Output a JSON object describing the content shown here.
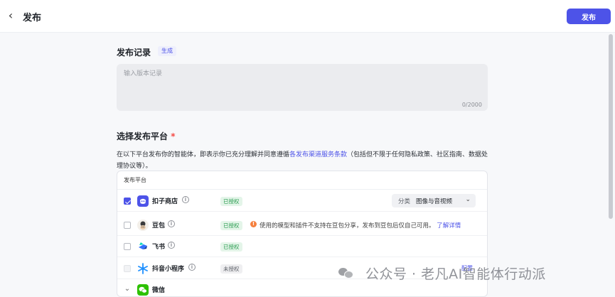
{
  "header": {
    "back_icon": "chevron-left-icon",
    "title": "发布",
    "publish_label": "发布",
    "accent_color": "#4d53e8"
  },
  "record": {
    "heading": "发布记录",
    "generate_label": "生成",
    "placeholder": "输入版本记录",
    "value": "",
    "counter": "0/2000"
  },
  "platforms": {
    "heading": "选择发布平台",
    "required_mark": "*",
    "description_before": "在以下平台发布你的智能体，即表示你已充分理解并同意遵循",
    "description_link": "各发布渠道服务条款",
    "description_after": "（包括但不限于任何隐私政策、社区指南、数据处理协议等）。",
    "table_header": "发布平台",
    "items": [
      {
        "name": "扣子商店",
        "icon": "coze-store-icon",
        "checked": true,
        "status": "已授权",
        "category_label": "分类",
        "category_value": "图像与音视频"
      },
      {
        "name": "豆包",
        "icon": "doubao-icon",
        "checked": false,
        "status": "已授权",
        "warning": "使用的模型和插件不支持在豆包分享，发布到豆包后仅自己可用。",
        "warning_link": "了解详情"
      },
      {
        "name": "飞书",
        "icon": "feishu-icon",
        "checked": false,
        "status": "已授权"
      },
      {
        "name": "抖音小程序",
        "icon": "douyin-miniprogram-icon",
        "checked": false,
        "disabled": true,
        "status": "未授权",
        "action": "配置"
      },
      {
        "name": "微信",
        "icon": "wechat-icon",
        "expandable": true
      }
    ]
  },
  "watermark": {
    "text": "公众号 · 老凡AI智能体行动派",
    "icon": "wechat-logo-icon"
  }
}
